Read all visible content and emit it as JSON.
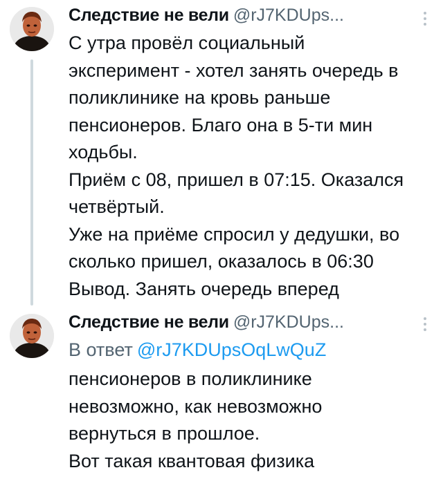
{
  "tweets": [
    {
      "author_name": "Следствие не вели",
      "author_handle": "@rJ7KDUps...",
      "lines": [
        "С утра провёл социальный",
        "эксперимент - хотел занять очередь в",
        "поликлинике на кровь раньше",
        "пенсионеров. Благо она в 5-ти мин",
        "ходьбы.",
        "Приём с 08, пришел в 07:15. Оказался",
        "четвёртый.",
        "Уже на приёме спросил у дедушки, во",
        "сколько пришел, оказалось в 06:30",
        "Вывод. Занять очередь вперед"
      ]
    },
    {
      "author_name": "Следствие не вели",
      "author_handle": "@rJ7KDUps...",
      "reply_prefix": "В ответ",
      "reply_handle": "@rJ7KDUpsOqLwQuZ",
      "lines": [
        "пенсионеров в поликлинике",
        "невозможно, как невозможно",
        "вернуться в прошлое.",
        "Вот такая квантовая физика"
      ]
    }
  ],
  "icons": {
    "avatar": "avatar-portrait",
    "more": "more-vertical-icon"
  },
  "colors": {
    "text": "#0f1419",
    "secondary": "#536471",
    "link": "#1d9bf0",
    "thread_line": "#cfd9de"
  }
}
